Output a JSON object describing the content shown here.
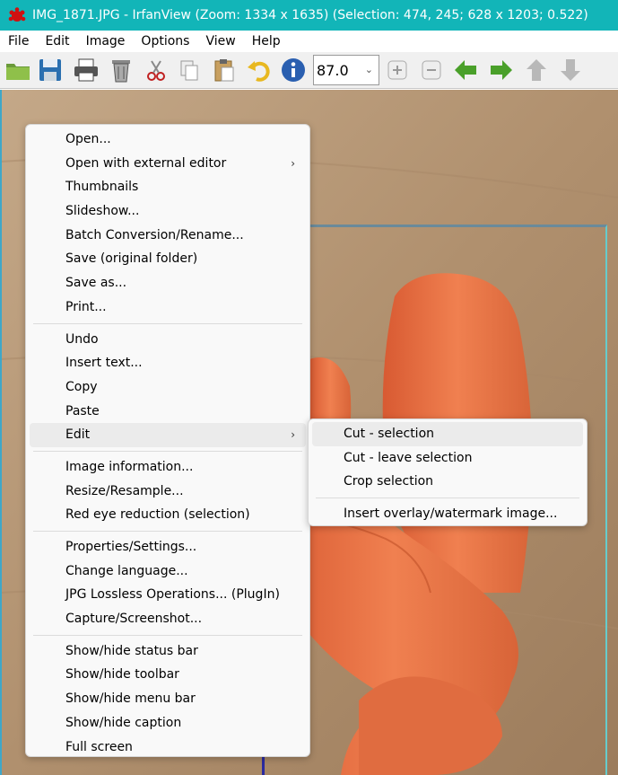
{
  "window": {
    "title": "IMG_1871.JPG - IrfanView (Zoom: 1334 x 1635) (Selection: 474, 245; 628 x 1203; 0.522)"
  },
  "menubar": [
    "File",
    "Edit",
    "Image",
    "Options",
    "View",
    "Help"
  ],
  "toolbar": {
    "zoom_value": "87.0",
    "icons": [
      "open-folder-icon",
      "save-icon",
      "print-icon",
      "delete-icon",
      "cut-icon",
      "copy-icon",
      "paste-icon",
      "undo-icon",
      "info-icon",
      "zoom-in-icon",
      "zoom-out-icon",
      "previous-icon",
      "next-icon",
      "up-icon",
      "down-icon"
    ]
  },
  "context_menu": {
    "groups": [
      [
        {
          "label": "Open...",
          "submenu": false
        },
        {
          "label": "Open with external editor",
          "submenu": true
        },
        {
          "label": "Thumbnails",
          "submenu": false
        },
        {
          "label": "Slideshow...",
          "submenu": false
        },
        {
          "label": "Batch Conversion/Rename...",
          "submenu": false
        },
        {
          "label": "Save (original folder)",
          "submenu": false
        },
        {
          "label": "Save as...",
          "submenu": false
        },
        {
          "label": "Print...",
          "submenu": false
        }
      ],
      [
        {
          "label": "Undo",
          "submenu": false
        },
        {
          "label": "Insert text...",
          "submenu": false
        },
        {
          "label": "Copy",
          "submenu": false
        },
        {
          "label": "Paste",
          "submenu": false
        },
        {
          "label": "Edit",
          "submenu": true,
          "highlighted": true
        }
      ],
      [
        {
          "label": "Image information...",
          "submenu": false
        },
        {
          "label": "Resize/Resample...",
          "submenu": false
        },
        {
          "label": "Red eye reduction (selection)",
          "submenu": false
        }
      ],
      [
        {
          "label": "Properties/Settings...",
          "submenu": false
        },
        {
          "label": "Change language...",
          "submenu": false
        },
        {
          "label": "JPG Lossless Operations... (PlugIn)",
          "submenu": false
        },
        {
          "label": "Capture/Screenshot...",
          "submenu": false
        }
      ],
      [
        {
          "label": "Show/hide status bar",
          "submenu": false
        },
        {
          "label": "Show/hide toolbar",
          "submenu": false
        },
        {
          "label": "Show/hide menu bar",
          "submenu": false
        },
        {
          "label": "Show/hide caption",
          "submenu": false
        },
        {
          "label": "Full screen",
          "submenu": false
        }
      ]
    ]
  },
  "edit_submenu": {
    "groups": [
      [
        {
          "label": "Cut - selection",
          "highlighted": true
        },
        {
          "label": "Cut - leave selection"
        },
        {
          "label": "Crop selection"
        }
      ],
      [
        {
          "label": "Insert overlay/watermark image..."
        }
      ]
    ]
  },
  "colors": {
    "titlebar": "#12b5b8",
    "menu_highlight": "#ebebeb",
    "carrot": "#e8704a"
  }
}
